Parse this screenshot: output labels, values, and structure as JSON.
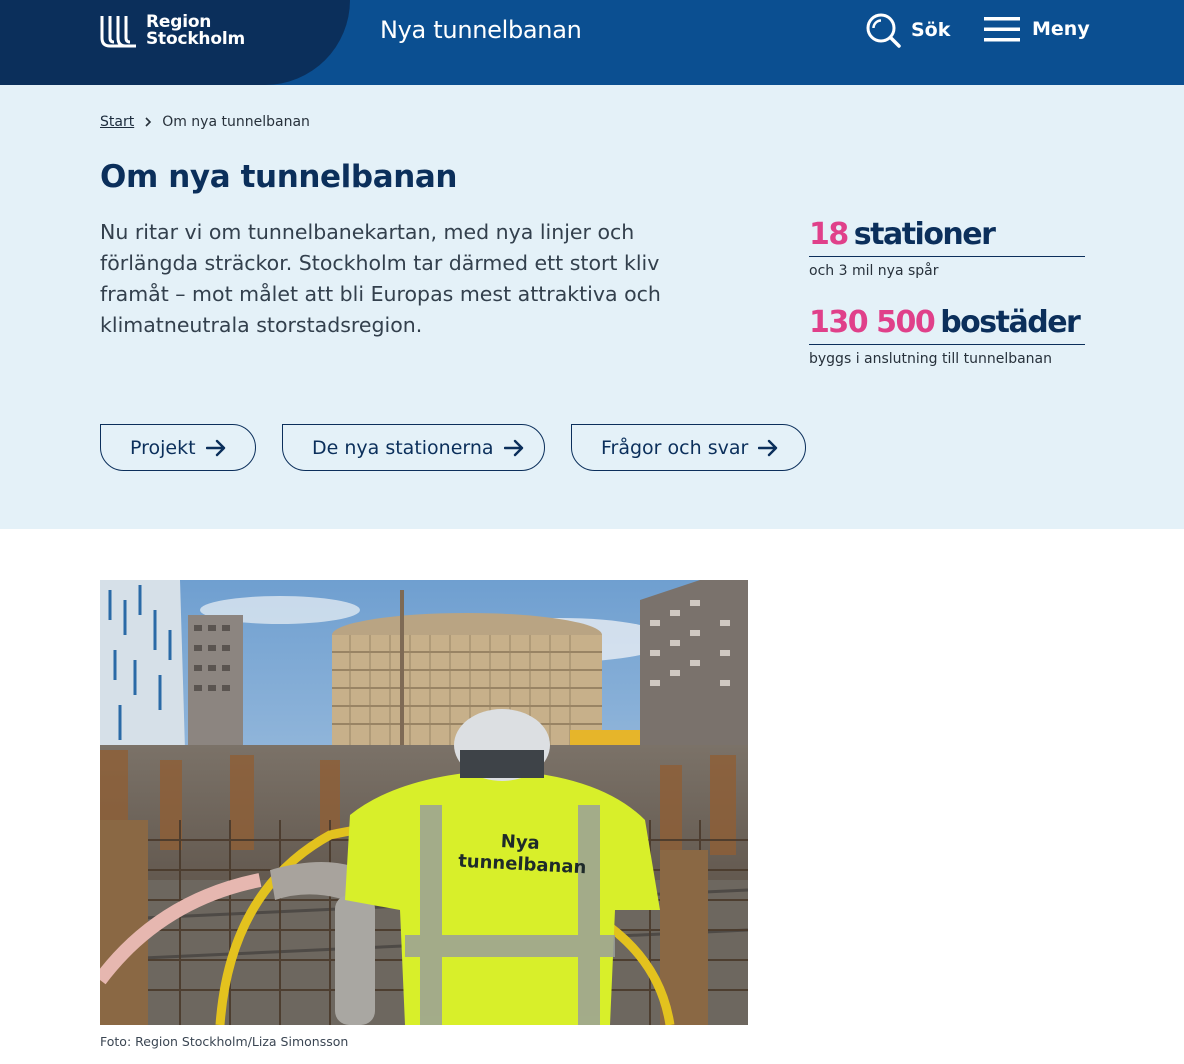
{
  "header": {
    "logo": {
      "line1": "Region",
      "line2": "Stockholm",
      "icon": "region-stockholm-logo-mark"
    },
    "site_title": "Nya tunnelbanan",
    "search": {
      "label": "Sök",
      "icon": "search-icon"
    },
    "menu": {
      "label": "Meny",
      "icon": "hamburger-menu-icon"
    }
  },
  "breadcrumb": {
    "items": [
      {
        "label": "Start",
        "link": true
      },
      {
        "label": "Om nya tunnelbanan",
        "link": false
      }
    ],
    "separator_icon": "chevron-right-icon"
  },
  "page": {
    "title": "Om nya tunnelbanan",
    "lead": "Nu ritar vi om tunnelbanekartan, med nya linjer och förlängda sträckor. Stockholm tar därmed ett stort kliv framåt – mot målet att bli Europas mest attraktiva och klimatneutrala storstadsregion."
  },
  "stats": [
    {
      "number": "18",
      "word": "stationer",
      "sub": "och 3 mil nya spår"
    },
    {
      "number": "130 500",
      "word": "bostäder",
      "sub": "byggs i anslutning till tunnelbanan"
    }
  ],
  "buttons": [
    {
      "label": "Projekt",
      "icon": "arrow-right-icon"
    },
    {
      "label": "De nya stationerna",
      "icon": "arrow-right-icon"
    },
    {
      "label": "Frågor och svar",
      "icon": "arrow-right-icon"
    }
  ],
  "photo": {
    "vest_line1": "Nya",
    "vest_line2": "tunnelbanan",
    "caption": "Foto: Region Stockholm/Liza Simonsson"
  },
  "colors": {
    "header_blue": "#0b4f91",
    "logo_navy": "#0b2f5b",
    "hero_bg": "#e4f1f8",
    "accent_pink": "#e0408a"
  }
}
